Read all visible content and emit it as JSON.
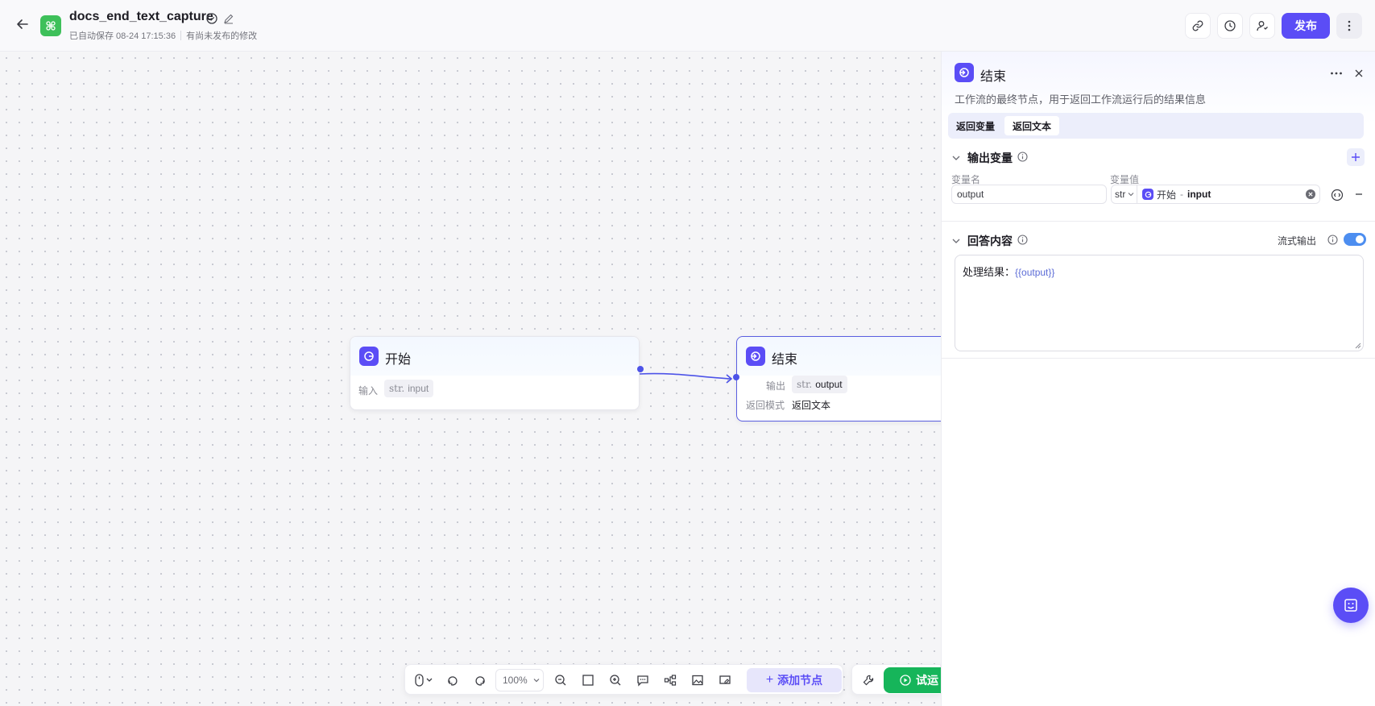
{
  "header": {
    "title": "docs_end_text_capture",
    "autosave": "已自动保存 08-24 17:15:36",
    "unpublished": "有尚未发布的修改",
    "publish_label": "发布"
  },
  "canvas": {
    "start_node": {
      "title": "开始",
      "input_label": "输入",
      "var_type": "str.",
      "var_name": "input"
    },
    "end_node": {
      "title": "结束",
      "output_label": "输出",
      "var_type": "str.",
      "var_name": "output",
      "mode_label": "返回模式",
      "mode_value": "返回文本"
    }
  },
  "toolbar": {
    "zoom": "100%",
    "add_node_label": "添加节点",
    "run_label": "试运"
  },
  "panel": {
    "title": "结束",
    "description": "工作流的最终节点，用于返回工作流运行后的结果信息",
    "tabs": [
      {
        "label": "返回变量",
        "active": false
      },
      {
        "label": "返回文本",
        "active": true
      }
    ],
    "output_section": {
      "title": "输出变量",
      "col_name": "变量名",
      "col_value": "变量值",
      "var_name": "output",
      "var_type": "str",
      "ref_node": "开始",
      "ref_sep": "-",
      "ref_var": "input"
    },
    "answer_section": {
      "title": "回答内容",
      "stream_label": "流式输出",
      "stream_enabled": true,
      "content_prefix": "处理结果：",
      "content_var": "{{output}}"
    }
  },
  "colors": {
    "accent": "#5b4df6",
    "run_green": "#16b55a",
    "logo_green": "#3ec05a",
    "edge": "#4d53e8"
  }
}
